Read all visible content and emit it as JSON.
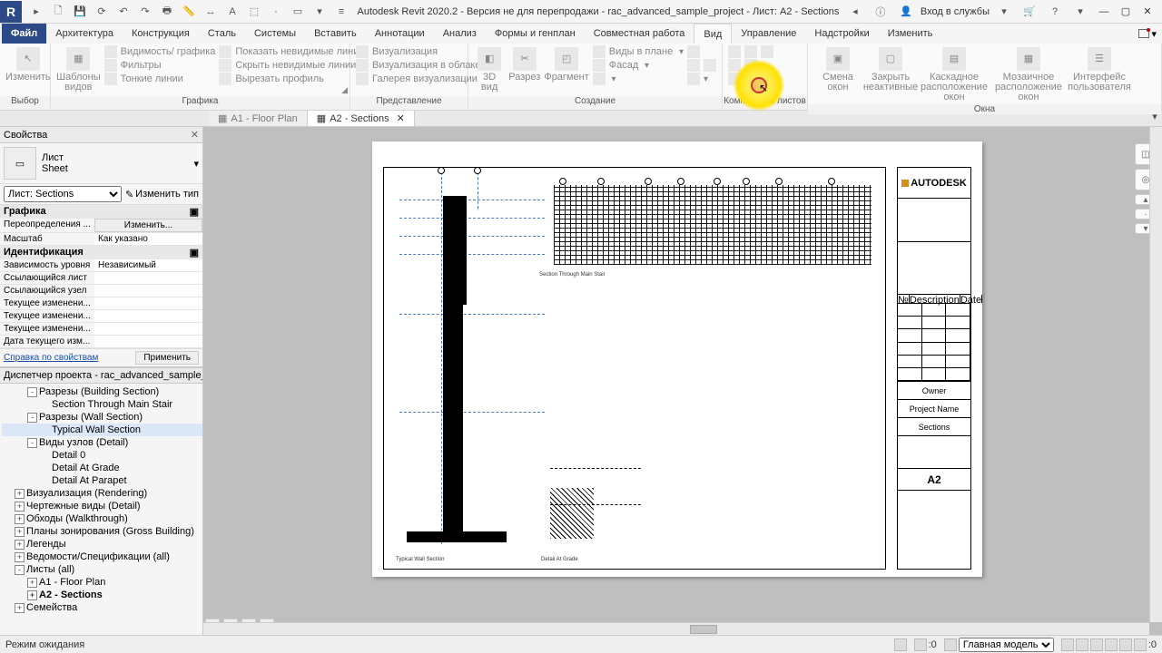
{
  "title": "Autodesk Revit 2020.2 - Версия не для перепродажи - rac_advanced_sample_project - Лист: A2 - Sections",
  "title_right": {
    "signin": "Вход в службы"
  },
  "menu": {
    "file": "Файл",
    "items": [
      "Архитектура",
      "Конструкция",
      "Сталь",
      "Системы",
      "Вставить",
      "Аннотации",
      "Анализ",
      "Формы и генплан",
      "Совместная работа",
      "Вид",
      "Управление",
      "Надстройки",
      "Изменить"
    ],
    "active": "Вид"
  },
  "ribbon": {
    "g_select": {
      "big": "Изменить",
      "label": "Выбор"
    },
    "g_graphics": {
      "big": "Шаблоны\nвидов",
      "rows": [
        "Видимость/ графика",
        "Фильтры",
        "Тонкие линии",
        "Показать невидимые линии",
        "Скрыть невидимые линии",
        "Вырезать профиль"
      ],
      "label": "Графика"
    },
    "g_present": {
      "rows": [
        "Визуализация",
        "Визуализация в облаке",
        "Галерея визуализации"
      ],
      "label": "Представление"
    },
    "g_create": {
      "bigs": [
        "3D\nвид",
        "Разрез",
        "Фрагмент"
      ],
      "rows": [
        "Виды в плане",
        "Фасад"
      ],
      "label": "Создание"
    },
    "g_sheets": {
      "label": "Композиция листов"
    },
    "g_windows": {
      "bigs": [
        "Смена\nокон",
        "Закрыть\nнеактивные",
        "Каскадное\nрасположение окон",
        "Мозаичное\nрасположение окон",
        "Интерфейс\nпользователя"
      ],
      "label": "Окна"
    }
  },
  "tabs": [
    {
      "label": "A1 - Floor Plan",
      "active": false
    },
    {
      "label": "A2 - Sections",
      "active": true
    }
  ],
  "props": {
    "title": "Свойства",
    "type_main": "Лист",
    "type_sub": "Sheet",
    "instance_label": "Лист: Sections",
    "edit_type": "Изменить тип",
    "sections": {
      "grafika": "Графика",
      "grafika_rows": [
        {
          "k": "Переопределения ...",
          "v": "Изменить...",
          "btn": true
        },
        {
          "k": "Масштаб",
          "v": "Как указано"
        }
      ],
      "ident": "Идентификация",
      "ident_rows": [
        {
          "k": "Зависимость уровня",
          "v": "Независимый"
        },
        {
          "k": "Ссылающийся лист",
          "v": ""
        },
        {
          "k": "Ссылающийся узел",
          "v": ""
        },
        {
          "k": "Текущее изменени...",
          "v": ""
        },
        {
          "k": "Текущее изменени...",
          "v": ""
        },
        {
          "k": "Текущее изменени...",
          "v": ""
        },
        {
          "k": "Дата текущего изм...",
          "v": ""
        }
      ]
    },
    "help": "Справка по свойствам",
    "apply": "Применить"
  },
  "browser": {
    "title": "Диспетчер проекта - rac_advanced_sample_proj...",
    "nodes": [
      {
        "lvl": 1,
        "tw": "-",
        "label": "Разрезы (Building Section)"
      },
      {
        "lvl": 2,
        "label": "Section Through Main Stair"
      },
      {
        "lvl": 1,
        "tw": "-",
        "label": "Разрезы (Wall Section)"
      },
      {
        "lvl": 2,
        "label": "Typical Wall Section",
        "sel": true
      },
      {
        "lvl": 1,
        "tw": "-",
        "label": "Виды узлов (Detail)"
      },
      {
        "lvl": 2,
        "label": "Detail 0"
      },
      {
        "lvl": 2,
        "label": "Detail At Grade"
      },
      {
        "lvl": 2,
        "label": "Detail At Parapet"
      },
      {
        "lvl": 0,
        "tw": "+",
        "label": "Визуализация (Rendering)"
      },
      {
        "lvl": 0,
        "tw": "+",
        "label": "Чертежные виды (Detail)"
      },
      {
        "lvl": 0,
        "tw": "+",
        "label": "Обходы (Walkthrough)"
      },
      {
        "lvl": 0,
        "tw": "+",
        "label": "Планы зонирования (Gross Building)"
      },
      {
        "lvl": 0,
        "tw": "+",
        "label": "Легенды"
      },
      {
        "lvl": 0,
        "tw": "+",
        "label": "Ведомости/Спецификации (all)"
      },
      {
        "lvl": 0,
        "tw": "-",
        "label": "Листы (all)"
      },
      {
        "lvl": 1,
        "tw": "+",
        "label": "A1 - Floor Plan"
      },
      {
        "lvl": 1,
        "tw": "+",
        "label": "A2 - Sections",
        "bold": true
      },
      {
        "lvl": 0,
        "tw": "+",
        "label": "Семейства"
      }
    ]
  },
  "titleblock": {
    "logo": "AUTODESK",
    "grid_h": [
      "№",
      "Description",
      "Date"
    ],
    "owner": "Owner",
    "project": "Project Name",
    "sheet": "Sections",
    "num": "A2"
  },
  "viewlabels": {
    "v1": "Section Through Main Stair",
    "v2": "Typical Wall Section",
    "v3": "Detail At Grade"
  },
  "status": {
    "mode": "Режим ожидания",
    "zero": ":0",
    "model": "Главная модель"
  }
}
